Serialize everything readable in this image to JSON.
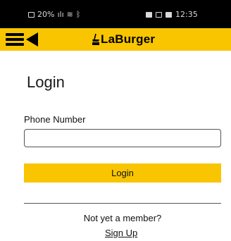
{
  "status_bar": {
    "battery": "20%",
    "time": "12:35",
    "signal_glyph": "ılı",
    "wifi_glyph": "≋",
    "extra_glyph": "ᛒ",
    "left_icons": [
      "battery-icon",
      "signal-icon",
      "wifi-icon"
    ],
    "right_icons": [
      "notification-icon",
      "screen-icon",
      "image-icon"
    ]
  },
  "app_bar": {
    "logo_text": "LaBurger",
    "background_color": "#f8c500"
  },
  "login": {
    "title": "Login",
    "phone_label": "Phone Number",
    "phone_value": "",
    "button_label": "Login",
    "button_color": "#f8c500",
    "signup_prompt": "Not yet a member?",
    "signup_link": "Sign Up"
  }
}
